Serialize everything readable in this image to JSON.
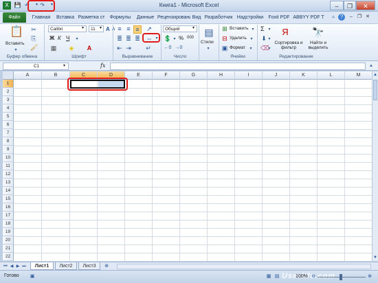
{
  "window": {
    "title": "Книга1 - Microsoft Excel",
    "minimize": "–",
    "restore": "❐",
    "close": "✕"
  },
  "tabs": [
    "Файл",
    "Главная",
    "Вставка",
    "Разметка ст",
    "Формулы",
    "Данные",
    "Рецензирование",
    "Вид",
    "Разработчик",
    "Надстройки",
    "Foxit PDF",
    "ABBYY PDF T"
  ],
  "ribbon": {
    "clipboard": {
      "paste": "Вставить",
      "label": "Буфер обмена"
    },
    "font": {
      "name": "Calibri",
      "size": "11",
      "bold": "Ж",
      "italic": "К",
      "underline": "Ч",
      "grow": "A",
      "shrink": "A",
      "label": "Шрифт"
    },
    "alignment": {
      "label": "Выравнивание"
    },
    "number": {
      "format": "Общий",
      "percent": "%",
      "thousands": "000",
      "label": "Число"
    },
    "styles": {
      "label": "Стили"
    },
    "cells": {
      "insert": "Вставить",
      "delete": "Удалить",
      "format": "Формат",
      "label": "Ячейки"
    },
    "editing": {
      "sigma": "Σ",
      "sort": "Сортировка и фильтр",
      "find": "Найти и выделить",
      "label": "Редактирование"
    }
  },
  "formula_bar": {
    "namebox": "C1",
    "fx": "fx",
    "value": ""
  },
  "columns": [
    "A",
    "B",
    "C",
    "D",
    "E",
    "F",
    "G",
    "H",
    "I",
    "J",
    "K",
    "L",
    "M"
  ],
  "rows": [
    "1",
    "2",
    "3",
    "4",
    "5",
    "6",
    "7",
    "8",
    "9",
    "10",
    "11",
    "12",
    "13",
    "14",
    "15",
    "16",
    "17",
    "18",
    "19",
    "20",
    "21",
    "22"
  ],
  "sheets": [
    "Лист1",
    "Лист2",
    "Лист3"
  ],
  "status": {
    "ready": "Готово",
    "zoom": "100%",
    "watermark": "Userlife.com"
  },
  "colors": {
    "highlight": "#e01919",
    "selection": "#c5d9f1"
  }
}
